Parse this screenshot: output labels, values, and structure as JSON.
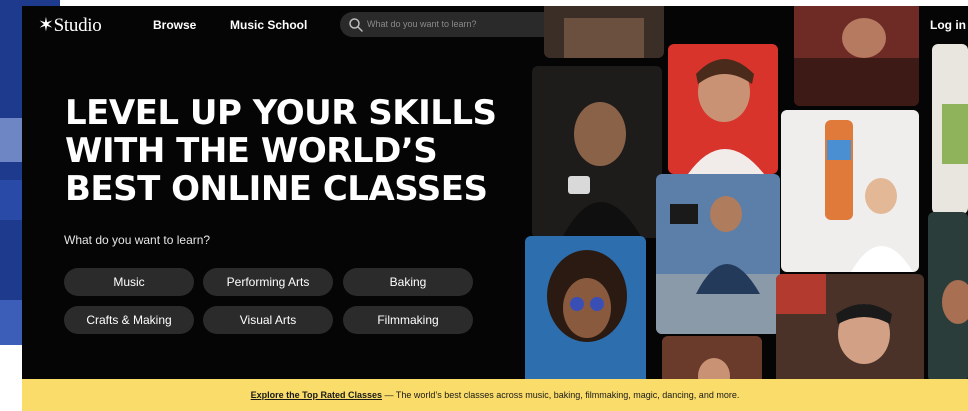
{
  "brand": {
    "logo": "✶Studio"
  },
  "nav": {
    "browse": "Browse",
    "music_school": "Music School",
    "login": "Log in"
  },
  "search": {
    "placeholder": "What do you want to learn?"
  },
  "hero": {
    "headline": [
      "LEVEL UP YOUR SKILLS",
      "WITH THE WORLD’S",
      "BEST ONLINE CLASSES"
    ],
    "question": "What do you want to learn?",
    "categories": [
      "Music",
      "Performing Arts",
      "Baking",
      "Crafts & Making",
      "Visual Arts",
      "Filmmaking"
    ]
  },
  "banner": {
    "link": "Explore the Top Rated Classes",
    "text": " — The world’s best classes across music, baking, filmmaking, magic, dancing, and more."
  },
  "icons": {
    "search": "search-icon",
    "cart": "cart-icon"
  },
  "colors": {
    "panel_bg": "#050505",
    "banner_bg": "#f9dc6a",
    "pill_bg": "#2b2b2b",
    "accent_red": "#d8342c"
  }
}
